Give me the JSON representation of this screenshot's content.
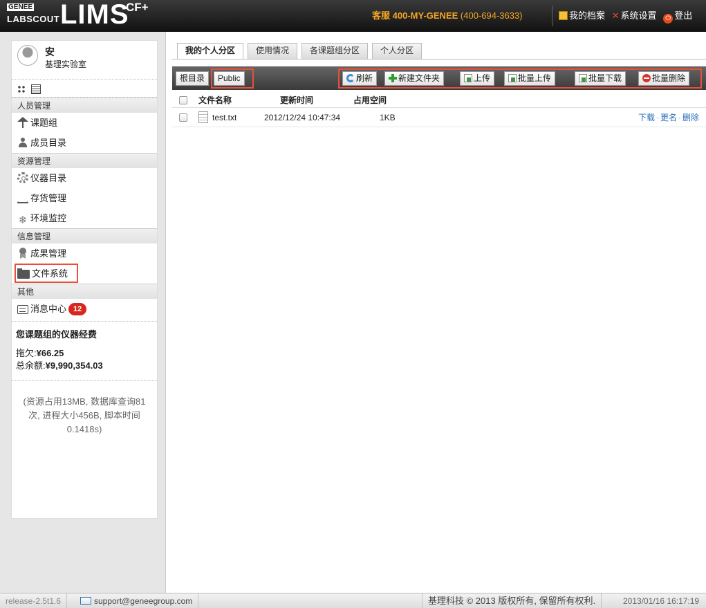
{
  "header": {
    "logo": {
      "genee": "GENEE",
      "labscout": "LABSCOUT",
      "lims": "LIMS",
      "cf": "CF+"
    },
    "hotline": {
      "label": "客服",
      "number": "400-MY-GENEE",
      "digits": "(400-694-3633)"
    },
    "links": [
      {
        "label": "我的档案",
        "icon": "edit-icon"
      },
      {
        "label": "系统设置",
        "icon": "tools-icon"
      },
      {
        "label": "登出",
        "icon": "power-icon"
      }
    ]
  },
  "sidebar": {
    "user": {
      "name": "安",
      "lab": "基理实验室"
    },
    "sections": [
      {
        "title": "人员管理",
        "items": [
          {
            "label": "课题组",
            "icon": "group-icon"
          },
          {
            "label": "成员目录",
            "icon": "member-icon"
          }
        ]
      },
      {
        "title": "资源管理",
        "items": [
          {
            "label": "仪器目录",
            "icon": "gear-icon"
          },
          {
            "label": "存货管理",
            "icon": "flask-icon"
          },
          {
            "label": "环境监控",
            "icon": "snowflake-icon"
          }
        ]
      },
      {
        "title": "信息管理",
        "items": [
          {
            "label": "成果管理",
            "icon": "award-icon"
          },
          {
            "label": "文件系统",
            "icon": "folder-icon"
          }
        ]
      },
      {
        "title": "其他",
        "items": [
          {
            "label": "消息中心",
            "icon": "message-icon",
            "badge": "12"
          }
        ]
      }
    ],
    "fund": {
      "title": "您课题组的仪器经费",
      "owed_label": "拖欠:",
      "owed_value": "¥66.25",
      "balance_label": "总余额:",
      "balance_value": "¥9,990,354.03"
    },
    "stats": "(资源占用13MB, 数据库查询81次, 进程大小456B, 脚本时间0.1418s)"
  },
  "main": {
    "tabs": [
      "我的个人分区",
      "使用情况",
      "各课题组分区",
      "个人分区"
    ],
    "active_tab": 0,
    "breadcrumb": {
      "root": "根目录",
      "current": "Public"
    },
    "toolbar": {
      "refresh": "刷新",
      "new_folder": "新建文件夹",
      "upload": "上传",
      "batch_upload": "批量上传",
      "batch_download": "批量下载",
      "batch_delete": "批量删除"
    },
    "columns": {
      "name": "文件名称",
      "time": "更新时间",
      "size": "占用空间"
    },
    "files": [
      {
        "name": "test.txt",
        "time": "2012/12/24 10:47:34",
        "size": "1KB",
        "actions": [
          "下载",
          "更名",
          "删除"
        ]
      }
    ]
  },
  "footer": {
    "release": "release-2.5t1.6",
    "email": "support@geneegroup.com",
    "copyright": "基理科技 © 2013 版权所有, 保留所有权利.",
    "timestamp": "2013/01/16 16:17:19"
  },
  "colors": {
    "highlight": "#e8503a",
    "link": "#2a6ebb",
    "hotline": "#f5a623",
    "badge": "#d8261c"
  }
}
